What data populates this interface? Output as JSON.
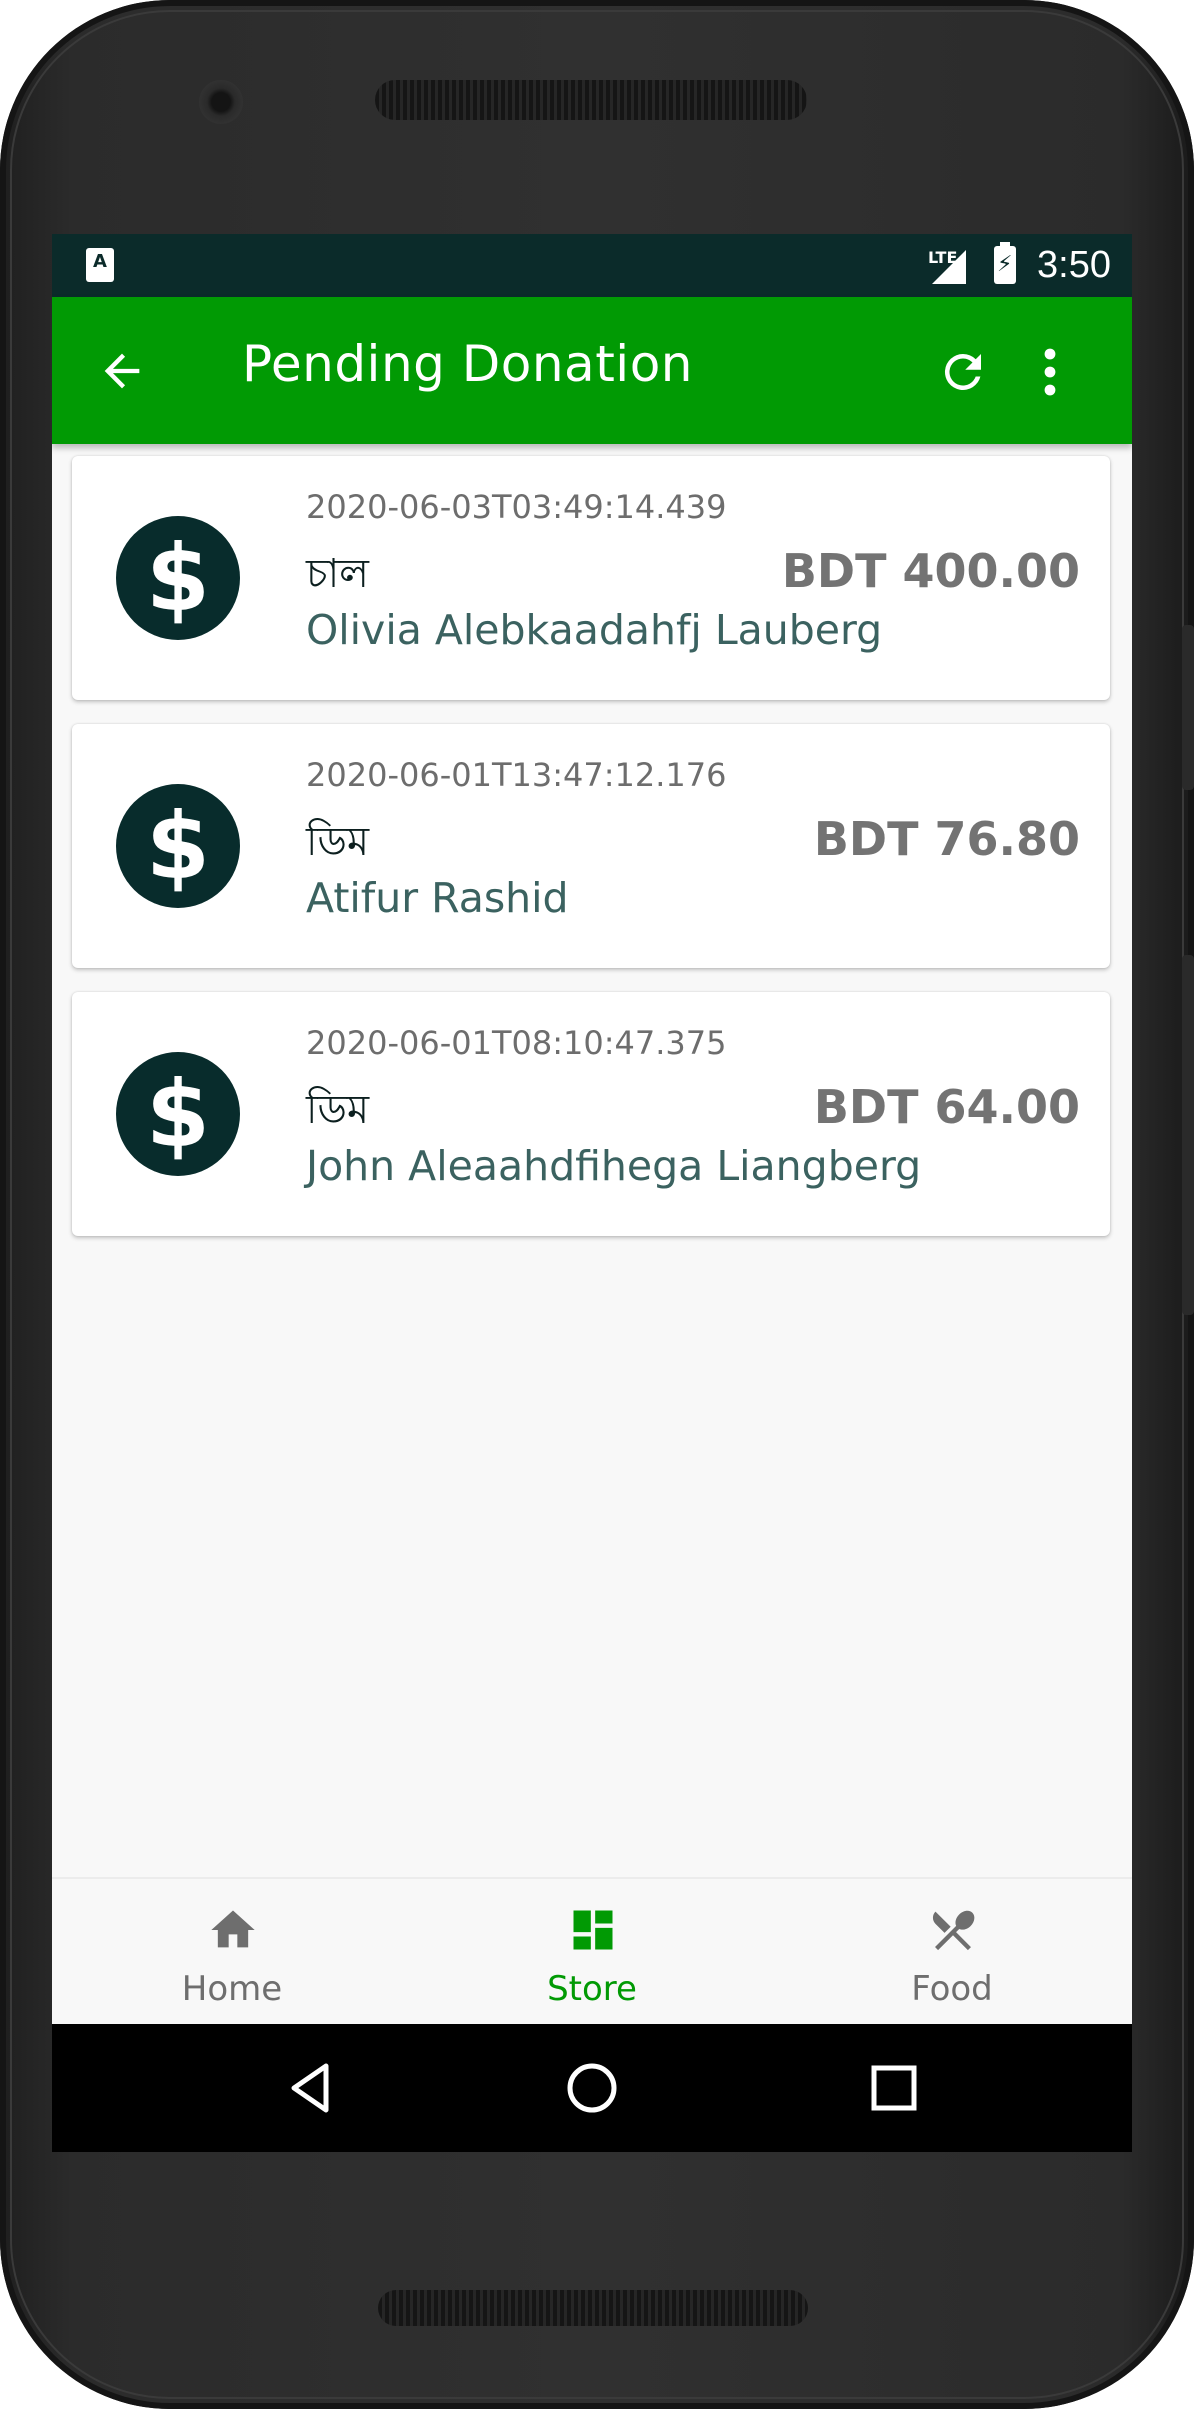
{
  "status_bar": {
    "network": "LTE",
    "time": "3:50"
  },
  "app_bar": {
    "title": "Pending Donation"
  },
  "donations": [
    {
      "timestamp": "2020-06-03T03:49:14.439",
      "item": "চাল",
      "amount": "BDT 400.00",
      "donor": "Olivia Alebkaadahfj Lauberg"
    },
    {
      "timestamp": "2020-06-01T13:47:12.176",
      "item": "ডিম",
      "amount": "BDT 76.80",
      "donor": "Atifur Rashid"
    },
    {
      "timestamp": "2020-06-01T08:10:47.375",
      "item": "ডিম",
      "amount": "BDT 64.00",
      "donor": "John Aleaahdfihega Liangberg"
    }
  ],
  "bottom_nav": [
    {
      "label": "Home",
      "icon": "home-icon",
      "active": false
    },
    {
      "label": "Store",
      "icon": "dashboard-icon",
      "active": true
    },
    {
      "label": "Food",
      "icon": "fork-spoon-icon",
      "active": false
    }
  ],
  "colors": {
    "primary": "#019a04",
    "status_bar": "#0b2b2a",
    "coin": "#082c2c",
    "donor_text": "#3b6260"
  }
}
